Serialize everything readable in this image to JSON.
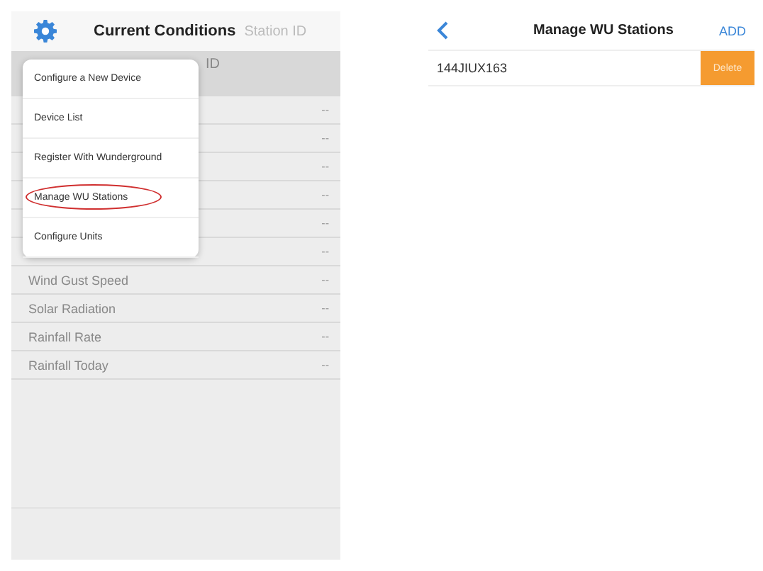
{
  "left_screen": {
    "title": "Current Conditions",
    "header_right": "Station ID",
    "subheader": "ID",
    "rows": [
      {
        "label": "",
        "value": "--"
      },
      {
        "label": "",
        "value": "--"
      },
      {
        "label": "",
        "value": "--"
      },
      {
        "label": "",
        "value": "--"
      },
      {
        "label": "",
        "value": "--"
      },
      {
        "label": "",
        "value": "--"
      },
      {
        "label": "Wind Gust Speed",
        "value": "--"
      },
      {
        "label": "Solar Radiation",
        "value": "--"
      },
      {
        "label": "Rainfall Rate",
        "value": "--"
      },
      {
        "label": "Rainfall Today",
        "value": "--"
      }
    ],
    "menu": {
      "items": [
        {
          "label": "Configure a New Device",
          "circled": false
        },
        {
          "label": "Device List",
          "circled": false
        },
        {
          "label": "Register With Wunderground",
          "circled": false
        },
        {
          "label": "Manage WU Stations",
          "circled": true
        },
        {
          "label": "Configure Units",
          "circled": false
        }
      ]
    }
  },
  "right_screen": {
    "title": "Manage WU Stations",
    "add": "ADD",
    "stations": [
      {
        "id": "144JIUX163",
        "delete": "Delete"
      }
    ]
  }
}
